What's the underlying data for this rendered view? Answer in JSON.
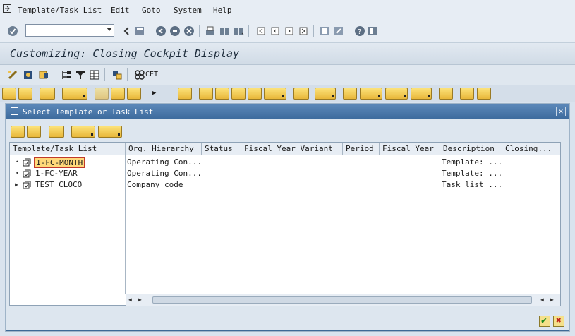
{
  "menu": {
    "items": [
      {
        "label": "Template/Task List"
      },
      {
        "label": "Edit"
      },
      {
        "label": "Goto"
      },
      {
        "label": "System"
      },
      {
        "label": "Help"
      }
    ]
  },
  "command_field": {
    "value": ""
  },
  "screen_title": "Customizing: Closing Cockpit Display",
  "app_toolbar": {
    "cet_label": "CET"
  },
  "dialog": {
    "title": "Select Template or Task List",
    "close_glyph": "✕",
    "columns": [
      {
        "label": "Template/Task List"
      },
      {
        "label": "Org. Hierarchy"
      },
      {
        "label": "Status"
      },
      {
        "label": "Fiscal Year Variant"
      },
      {
        "label": "Period"
      },
      {
        "label": "Fiscal Year"
      },
      {
        "label": "Description"
      },
      {
        "label": "Closing..."
      }
    ],
    "rows": [
      {
        "name": "1-FC-MONTH",
        "org_hierarchy": "Operating Con...",
        "description": "Template: ...",
        "expander": "•",
        "selected": true
      },
      {
        "name": "1-FC-YEAR",
        "org_hierarchy": "Operating Con...",
        "description": "Template: ...",
        "expander": "•",
        "selected": false
      },
      {
        "name": "TEST CLOCO",
        "org_hierarchy": "Company code",
        "description": "Task list ...",
        "expander": "▶",
        "selected": false
      }
    ],
    "ok_glyph": "✔",
    "cancel_glyph": "✖"
  },
  "colors": {
    "accent_yellow": "#fce27a",
    "dialog_title": "#3e6c9e",
    "selection": "#ffd97a",
    "ok_green": "#1f8a1f",
    "cancel_red": "#c0261c"
  }
}
